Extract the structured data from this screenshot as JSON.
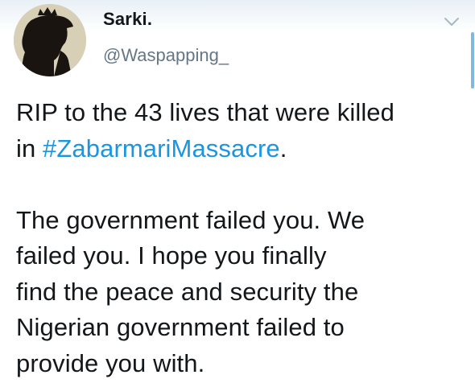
{
  "author": {
    "display_name": "Sarki.",
    "handle": "@Waspapping_"
  },
  "tweet": {
    "line1": "RIP to the 43 lives that were killed",
    "line2_prefix": "in ",
    "hashtag": "#ZabarmariMassacre",
    "line2_suffix": ".",
    "para2_line1": "The government failed you. We",
    "para2_line2": "failed you. I hope you finally",
    "para2_line3": "find the peace and security the",
    "para2_line4": "Nigerian government failed to",
    "para2_line5": "provide you with."
  },
  "icons": {
    "caret": "chevron-down-icon",
    "avatar": "silhouette-avatar"
  },
  "colors": {
    "hashtag": "#1b95e0",
    "handle": "#657786",
    "text": "#14171a",
    "avatar_bg": "#d8cfb7"
  }
}
